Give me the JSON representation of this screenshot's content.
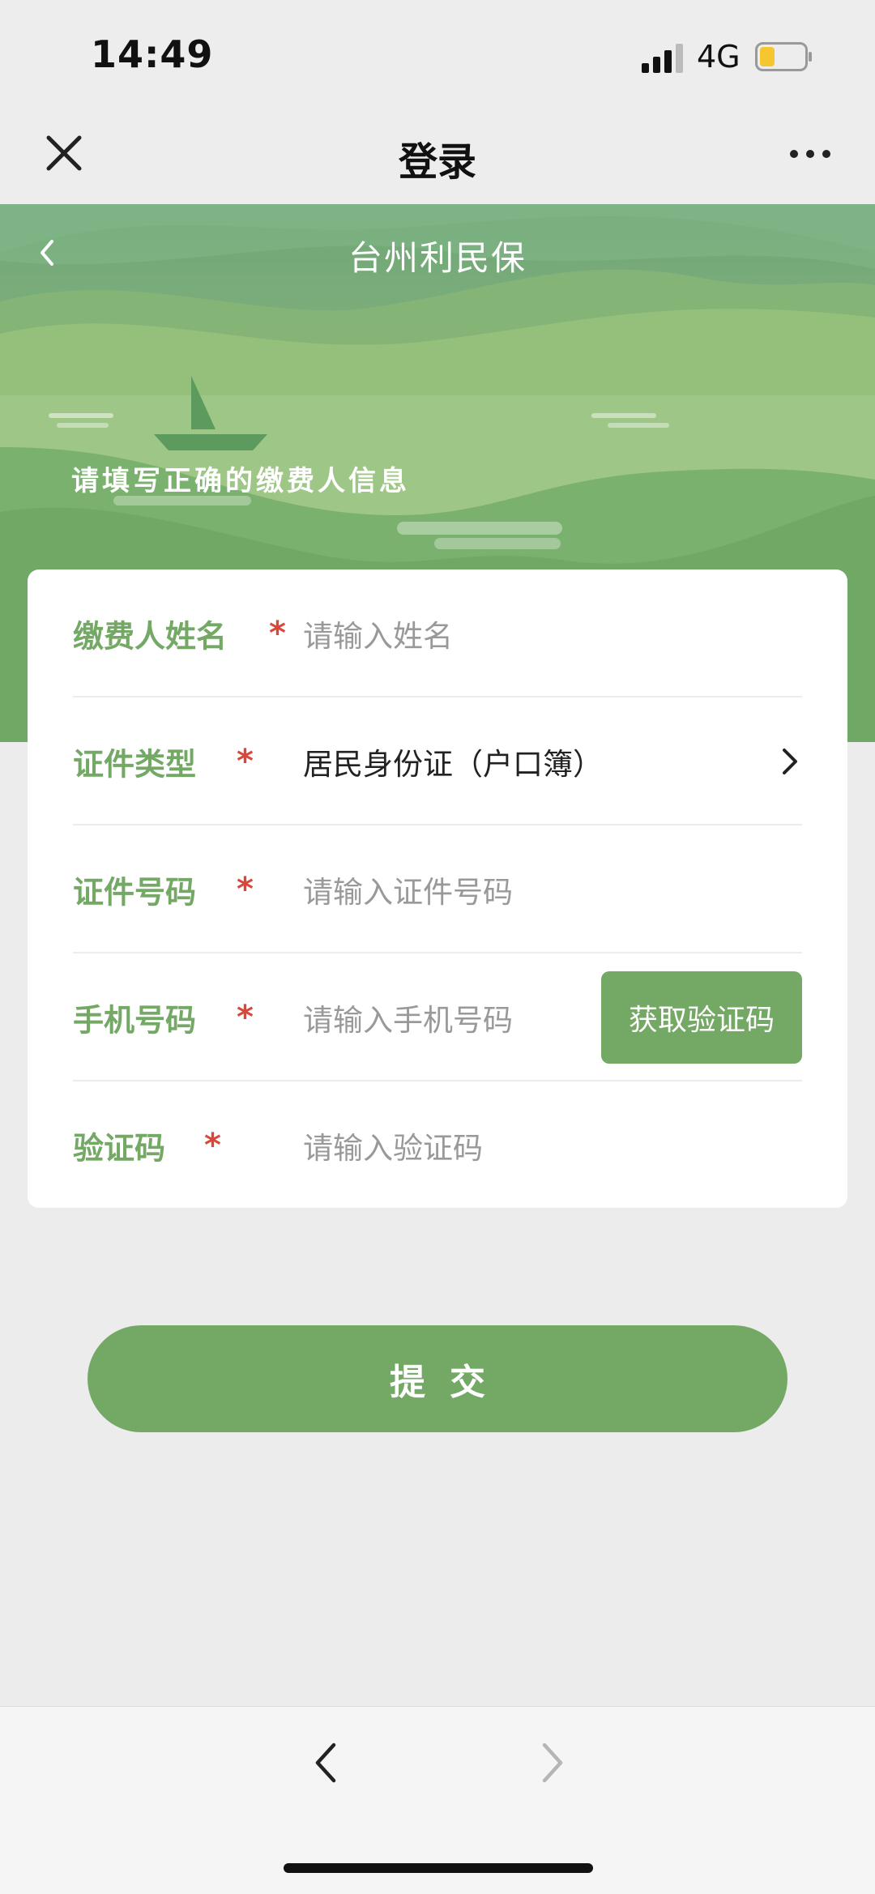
{
  "status_bar": {
    "time": "14:49",
    "network": "4G",
    "signal_icon": "signal-bars-icon",
    "battery_icon": "battery-low-icon"
  },
  "nav_bar": {
    "title": "登录",
    "close_icon": "close-icon",
    "more_icon": "more-dots-icon"
  },
  "banner": {
    "title": "台州利民保",
    "subtitle": "请填写正确的缴费人信息",
    "back_icon": "chevron-left-icon"
  },
  "form": {
    "rows": [
      {
        "label": "缴费人姓名",
        "required": "*",
        "placeholder": "请输入姓名"
      },
      {
        "label": "证件类型",
        "required": "*",
        "value": "居民身份证（户口簿）"
      },
      {
        "label": "证件号码",
        "required": "*",
        "placeholder": "请输入证件号码"
      },
      {
        "label": "手机号码",
        "required": "*",
        "placeholder": "请输入手机号码",
        "button": "获取验证码"
      },
      {
        "label": "验证码",
        "required": "*",
        "placeholder": "请输入验证码"
      }
    ]
  },
  "submit": {
    "label": "提交"
  },
  "colors": {
    "accent": "#73a865",
    "required": "#d9463a",
    "page_bg": "#ececec"
  }
}
